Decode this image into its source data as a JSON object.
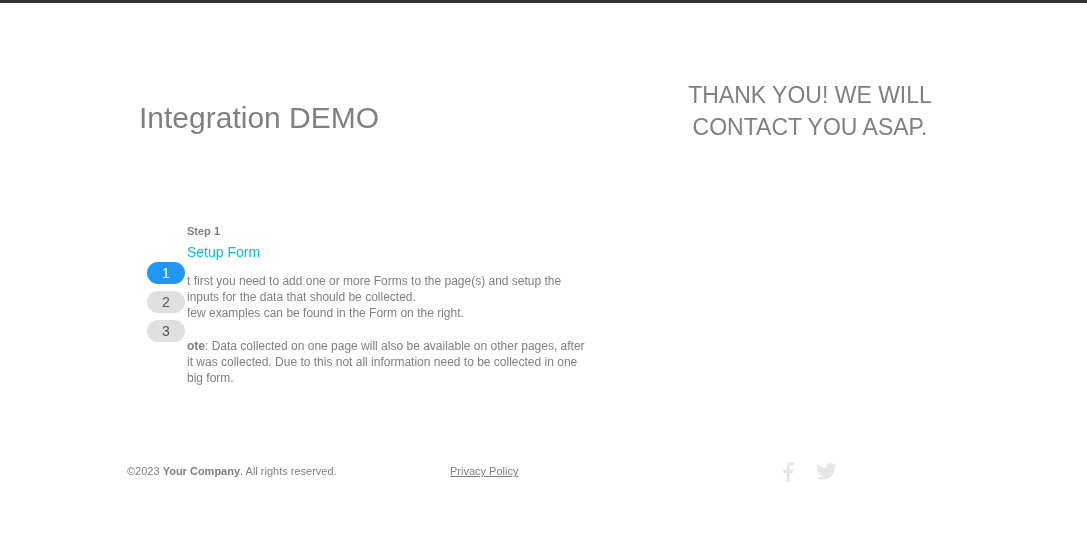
{
  "header": {
    "title": "Integration DEMO",
    "message": "THANK YOU! WE WILL CONTACT YOU ASAP."
  },
  "step": {
    "label": "Step 1",
    "title": "Setup Form",
    "dots": [
      {
        "label": "1",
        "selected": true
      },
      {
        "label": "2",
        "selected": false
      },
      {
        "label": "3",
        "selected": false
      }
    ],
    "paragraphs": [
      "t first you need to add one or more Forms to the page(s) and setup the inputs for the data that should be collected.",
      "few examples can be found in the Form on the right.",
      "**ote**: Data collected on one page will also be available on other pages, after it was collected. Due to this not all information need to be collected in one big form."
    ]
  },
  "footer": {
    "copyright": "©2023 **Your Company**. All rights reserved.",
    "privacy": "Privacy Policy"
  }
}
